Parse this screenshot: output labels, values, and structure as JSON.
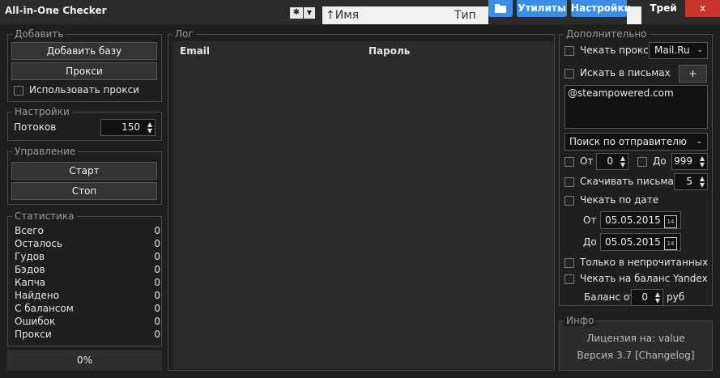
{
  "titlebar": {
    "title": "All-in-One Checker",
    "bg_sort": "Имя",
    "bg_type": "Тип",
    "util_label": "Утилиты",
    "settings_label": "Настройки",
    "tray_label": "Трей",
    "close_label": "x"
  },
  "add": {
    "legend": "Добавить",
    "add_base": "Добавить базу",
    "proxy": "Прокси",
    "use_proxy": "Использовать прокси"
  },
  "settings": {
    "legend": "Настройки",
    "threads_label": "Потоков",
    "threads_value": "150"
  },
  "control": {
    "legend": "Управление",
    "start": "Старт",
    "stop": "Стоп"
  },
  "stats": {
    "legend": "Статистика",
    "rows": [
      {
        "label": "Всего",
        "value": "0"
      },
      {
        "label": "Осталось",
        "value": "0"
      },
      {
        "label": "Гудов",
        "value": "0"
      },
      {
        "label": "Бэдов",
        "value": "0"
      },
      {
        "label": "Капча",
        "value": "0"
      },
      {
        "label": "Найдено",
        "value": "0"
      },
      {
        "label": "С балансом",
        "value": "0"
      },
      {
        "label": "Ошибок",
        "value": "0"
      },
      {
        "label": "Прокси",
        "value": "0"
      }
    ],
    "progress": "0%"
  },
  "log": {
    "legend": "Лог",
    "col_email": "Email",
    "col_password": "Пароль"
  },
  "extra": {
    "legend": "Дополнительно",
    "check_proxy": "Чекать прокси",
    "proxy_service": "Mail.Ru",
    "search_letters": "Искать в письмах",
    "plus": "+",
    "search_text": "@steampowered.com",
    "search_mode": "Поиск по отправителю",
    "from_label": "От",
    "from_value": "0",
    "to_label": "До",
    "to_value": "999",
    "download_letters": "Скачивать письма",
    "download_value": "5",
    "check_by_date": "Чекать по дате",
    "date_from_label": "От",
    "date_from": "05.05.2015",
    "date_to_label": "До",
    "date_to": "05.05.2015",
    "calendar_day": "14",
    "only_unread": "Только в непрочитанных",
    "yandex_balance": "Чекать на баланс Yandex",
    "balance_from_label": "Баланс от",
    "balance_value": "0",
    "balance_unit": "руб"
  },
  "info": {
    "legend": "Инфо",
    "license": "Лицензия на: value",
    "version": "Версия 3.7 [Changelog]"
  }
}
